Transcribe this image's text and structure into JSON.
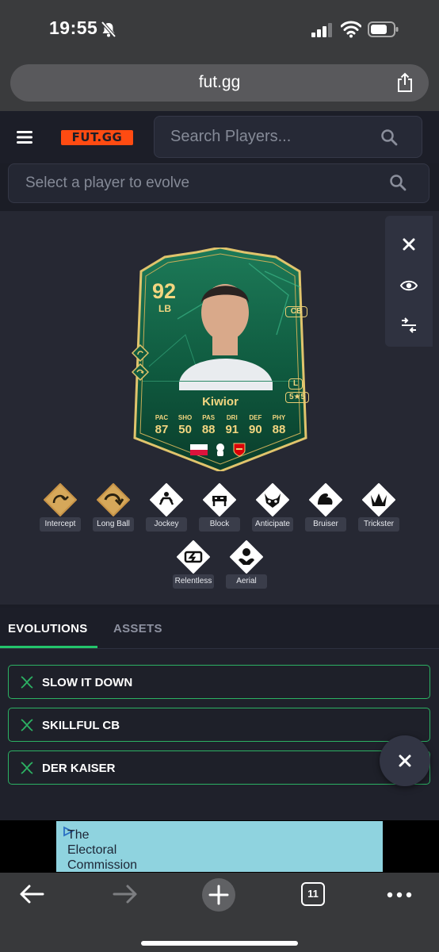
{
  "status_bar": {
    "time": "19:55"
  },
  "browser": {
    "url": "fut.gg",
    "tab_count": "11"
  },
  "site": {
    "logo": "FUT.GG",
    "search_placeholder": "Search Players...",
    "evolve_placeholder": "Select a player to evolve"
  },
  "card": {
    "rating": "92",
    "position": "LB",
    "alt_position": "CB",
    "foot": "L",
    "skills_weakfoot": "5★5",
    "name": "Kiwior",
    "stats": [
      {
        "label": "PAC",
        "value": "87"
      },
      {
        "label": "SHO",
        "value": "50"
      },
      {
        "label": "PAS",
        "value": "88"
      },
      {
        "label": "DRI",
        "value": "91"
      },
      {
        "label": "DEF",
        "value": "90"
      },
      {
        "label": "PHY",
        "value": "88"
      }
    ],
    "colors": {
      "card_green": "#0f5a3f",
      "gold": "#e8cc74"
    }
  },
  "playstyles": [
    {
      "label": "Intercept",
      "plus": true,
      "icon": "interception-icon"
    },
    {
      "label": "Long Ball",
      "plus": true,
      "icon": "long-ball-icon"
    },
    {
      "label": "Jockey",
      "plus": false,
      "icon": "jockey-icon"
    },
    {
      "label": "Block",
      "plus": false,
      "icon": "block-icon"
    },
    {
      "label": "Anticipate",
      "plus": false,
      "icon": "anticipate-icon"
    },
    {
      "label": "Bruiser",
      "plus": false,
      "icon": "bruiser-icon"
    },
    {
      "label": "Trickster",
      "plus": false,
      "icon": "trickster-icon"
    },
    {
      "label": "Relentless",
      "plus": false,
      "icon": "relentless-icon"
    },
    {
      "label": "Aerial",
      "plus": false,
      "icon": "aerial-icon"
    }
  ],
  "tabs": [
    {
      "label": "EVOLUTIONS",
      "active": true
    },
    {
      "label": "ASSETS",
      "active": false
    }
  ],
  "evolutions": [
    {
      "label": "SLOW IT DOWN"
    },
    {
      "label": "SKILLFUL CB"
    },
    {
      "label": "DER KAISER"
    }
  ],
  "ad": {
    "line1": "The",
    "line2": "Electoral",
    "line3": "Commission"
  },
  "colors": {
    "accent_green": "#23c46b",
    "logo_orange": "#ff4b12",
    "background": "#1b1d26"
  }
}
